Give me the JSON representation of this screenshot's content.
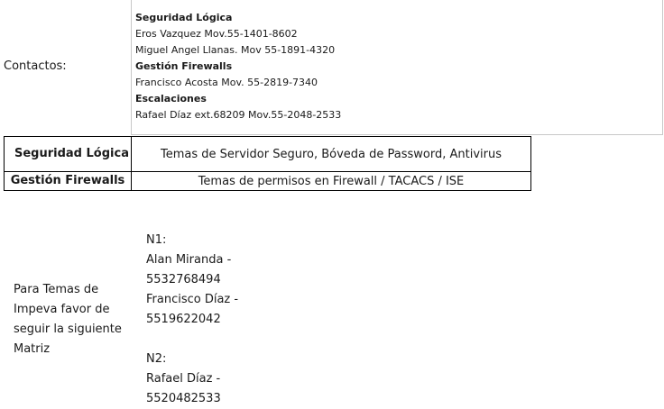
{
  "contacts": {
    "label": "Contactos:",
    "lines": [
      {
        "text": "Seguridad Lógica",
        "bold": true
      },
      {
        "text": "Eros Vazquez Mov.55-1401-8602",
        "bold": false
      },
      {
        "text": "Miguel Angel Llanas. Mov 55-1891-4320",
        "bold": false
      },
      {
        "text": "Gestión Firewalls",
        "bold": true
      },
      {
        "text": "Francisco Acosta Mov. 55-2819-7340",
        "bold": false
      },
      {
        "text": "Escalaciones",
        "bold": true
      },
      {
        "text": "Rafael Díaz ext.68209 Mov.55-2048-2533",
        "bold": false
      }
    ]
  },
  "areas": [
    {
      "name": "Seguridad Lógica",
      "description": "Temas de Servidor Seguro, Bóveda de Password, Antivirus"
    },
    {
      "name": "Gestión Firewalls",
      "description": "Temas de permisos en Firewall / TACACS / ISE"
    }
  ],
  "impeva": {
    "label": "Para Temas de Impeva favor de seguir la siguiente Matriz",
    "lines": [
      "N1:",
      "Alan Miranda -",
      "5532768494",
      "Francisco Díaz -",
      "5519622042",
      "",
      "N2:",
      "Rafael Díaz -",
      "5520482533"
    ]
  }
}
